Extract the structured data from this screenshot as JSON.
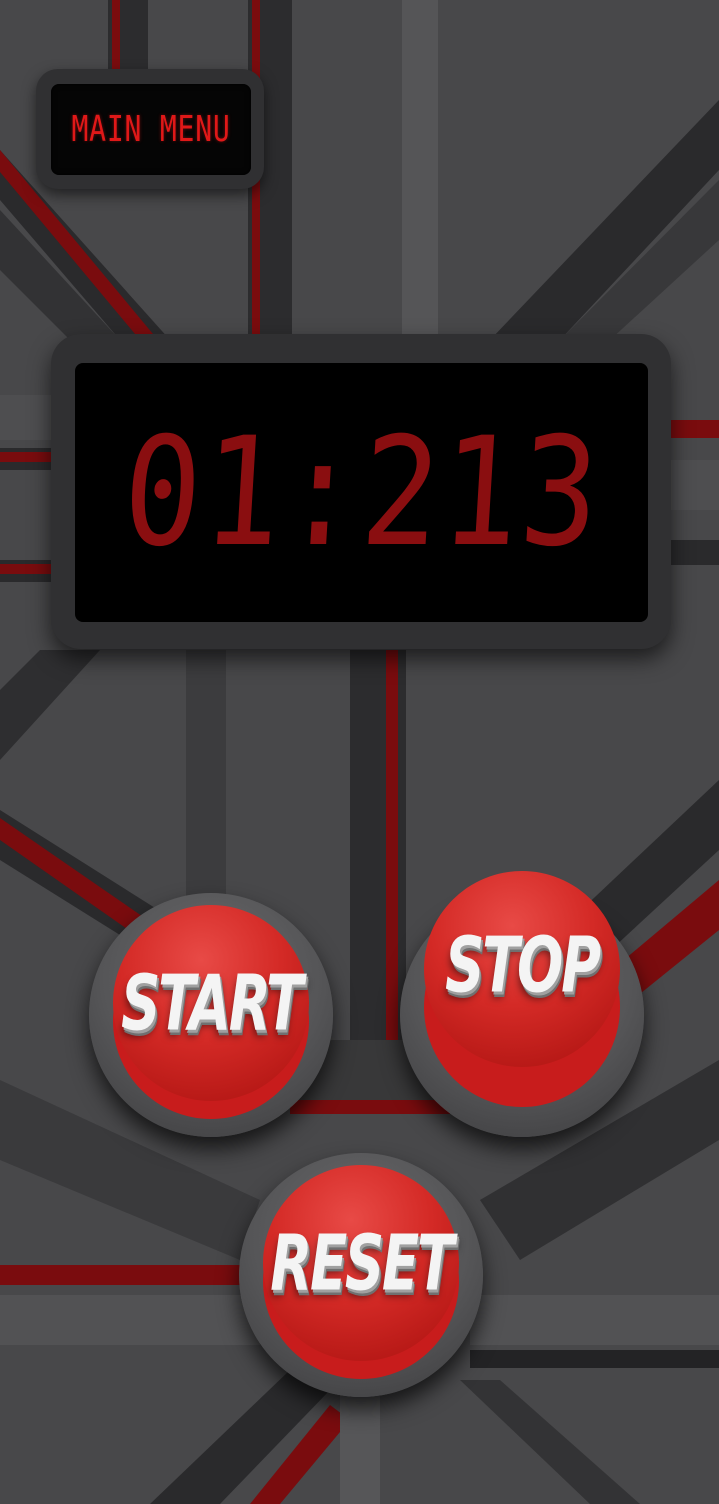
{
  "menu": {
    "label": "MAIN MENU"
  },
  "timer": {
    "display": "01:213"
  },
  "controls": {
    "start_label": "START",
    "stop_label": "STOP",
    "reset_label": "RESET"
  },
  "colors": {
    "accent": "#d42a26",
    "digit": "#8a0e10",
    "menu_text": "#e01818",
    "background": "#454547"
  }
}
